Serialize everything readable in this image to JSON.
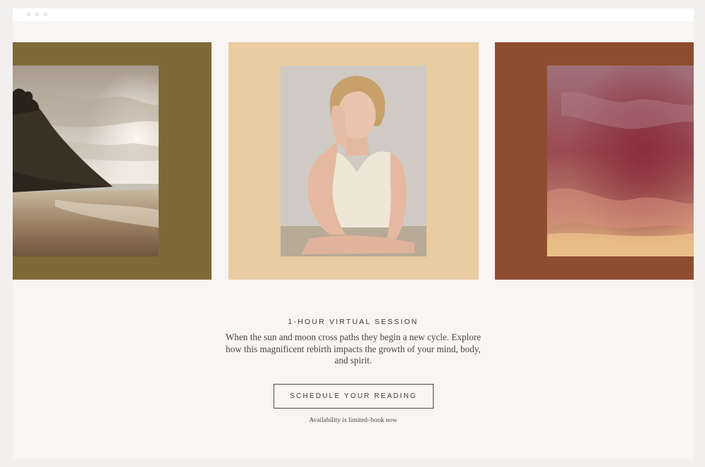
{
  "colors": {
    "page_background": "#f8f5f2",
    "panel_olive": "#7e6a38",
    "panel_sand": "#e9cca1",
    "panel_rust": "#8e4d2f",
    "text": "#3d3a36"
  },
  "gallery": {
    "panels": [
      {
        "name": "olive-panel",
        "photo": "coastal cliff and beach at dusk"
      },
      {
        "name": "sand-panel",
        "photo": "portrait of woman resting chin on hand"
      },
      {
        "name": "rust-panel",
        "photo": "pink and red cloudy sky"
      }
    ]
  },
  "session": {
    "title": "1-HOUR VIRTUAL SESSION",
    "description": "When the sun and moon cross paths they begin a new cycle. Explore how this magnificent rebirth impacts the growth of your mind, body, and spirit.",
    "cta_label": "SCHEDULE YOUR READING",
    "note": "Availability is limited–book now"
  }
}
